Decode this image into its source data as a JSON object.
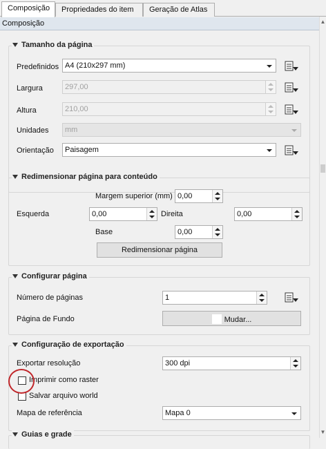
{
  "tabs": [
    {
      "label": "Composição",
      "active": true
    },
    {
      "label": "Propriedades do item",
      "active": false
    },
    {
      "label": "Geração de Atlas",
      "active": false
    }
  ],
  "panel_title": "Composição",
  "page_size": {
    "title": "Tamanho da página",
    "predef_label": "Predefinidos",
    "predef_value": "A4 (210x297 mm)",
    "width_label": "Largura",
    "width_value": "297,00",
    "height_label": "Altura",
    "height_value": "210,00",
    "units_label": "Unidades",
    "units_value": "mm",
    "orientation_label": "Orientação",
    "orientation_value": "Paisagem"
  },
  "resize": {
    "title": "Redimensionar página para conteúdo",
    "top_label": "Margem superior (mm)",
    "top_value": "0,00",
    "left_label": "Esquerda",
    "left_value": "0,00",
    "right_label": "Direita",
    "right_value": "0,00",
    "bottom_label": "Base",
    "bottom_value": "0,00",
    "button_label": "Redimensionar página"
  },
  "configure": {
    "title": "Configurar página",
    "pages_label": "Número de páginas",
    "pages_value": "1",
    "background_label": "Página de Fundo",
    "change_label": "Mudar..."
  },
  "export": {
    "title": "Configuração de exportação",
    "resolution_label": "Exportar resolução",
    "resolution_value": "300 dpi",
    "raster_label": "Imprimir como raster",
    "raster_checked": false,
    "world_label": "Salvar arquivo world",
    "world_checked": false,
    "ref_map_label": "Mapa de referência",
    "ref_map_value": "Mapa 0"
  },
  "next_group_partial": "Guias e grade",
  "colors": {
    "highlight_circle": "#c0262a",
    "title_strip": "#dfe6ee"
  }
}
